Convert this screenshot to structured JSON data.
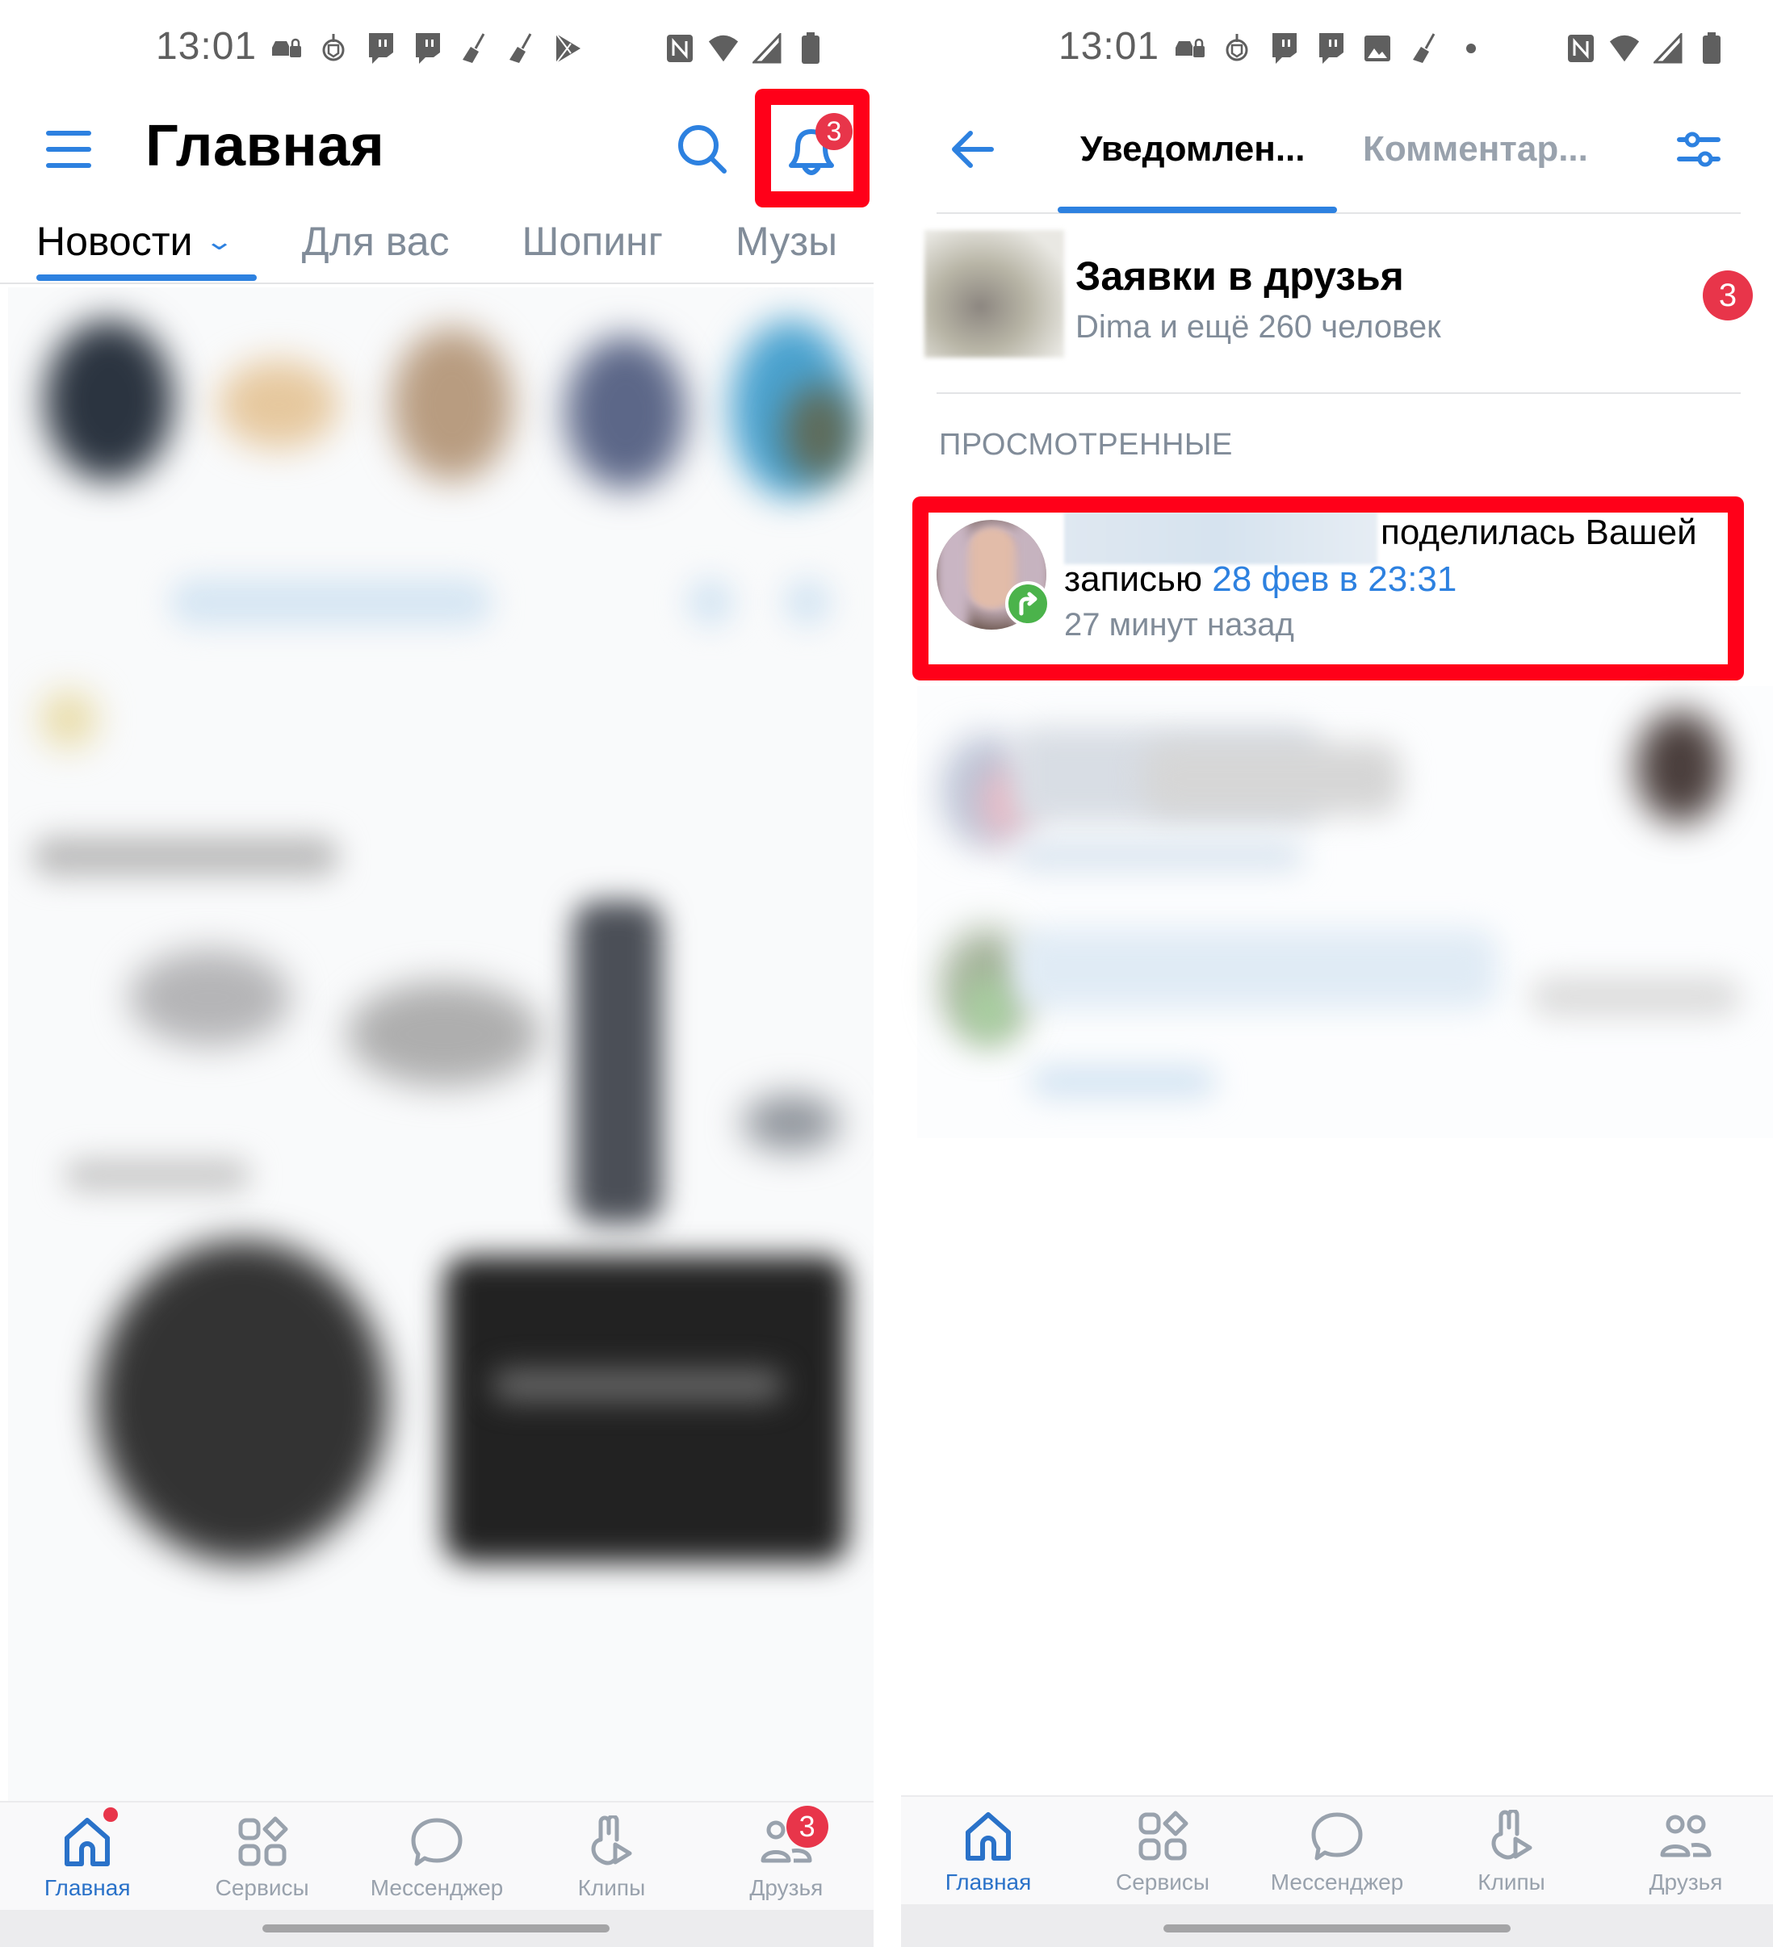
{
  "left": {
    "status_bar": {
      "time": "13:01",
      "notification_icons": [
        "car-lock-icon",
        "emblem-icon",
        "twitch-icon",
        "twitch-icon",
        "broom-icon",
        "broom-icon",
        "play-store-icon"
      ],
      "system_icons": [
        "nfc-icon",
        "wifi-icon",
        "signal-icon",
        "battery-icon"
      ]
    },
    "header": {
      "title": "Главная",
      "notifications_badge": "3"
    },
    "tabs": [
      {
        "label": "Новости",
        "active": true,
        "has_dropdown": true
      },
      {
        "label": "Для вас",
        "active": false
      },
      {
        "label": "Шопинг",
        "active": false
      },
      {
        "label": "Музыка",
        "active": false,
        "truncated_display": "Музы"
      }
    ],
    "bottom_nav": [
      {
        "label": "Главная",
        "icon": "home-icon",
        "active": true,
        "dot": true
      },
      {
        "label": "Сервисы",
        "icon": "services-icon",
        "active": false
      },
      {
        "label": "Мессенджер",
        "icon": "messenger-icon",
        "active": false
      },
      {
        "label": "Клипы",
        "icon": "clips-icon",
        "active": false
      },
      {
        "label": "Друзья",
        "icon": "friends-icon",
        "active": false,
        "badge": "3"
      }
    ]
  },
  "right": {
    "status_bar": {
      "time": "13:01",
      "notification_icons": [
        "car-lock-icon",
        "emblem-icon",
        "twitch-icon",
        "twitch-icon",
        "image-icon",
        "broom-icon",
        "dot-icon"
      ],
      "system_icons": [
        "nfc-icon",
        "wifi-icon",
        "signal-icon",
        "battery-icon"
      ]
    },
    "tabs": [
      {
        "label": "Уведомлен...",
        "active": true
      },
      {
        "label": "Комментар...",
        "active": false
      }
    ],
    "friend_requests": {
      "title": "Заявки в друзья",
      "subtitle": "Dima и ещё 260 человек",
      "badge": "3"
    },
    "section_header": "ПРОСМОТРЕННЫЕ",
    "notification": {
      "action_text": "поделилась Вашей",
      "object_text": "записью",
      "post_link": "28 фев в 23:31",
      "time_ago": "27 минут назад",
      "type_icon": "share-icon"
    },
    "bottom_nav": [
      {
        "label": "Главная",
        "icon": "home-icon",
        "active": true
      },
      {
        "label": "Сервисы",
        "icon": "services-icon",
        "active": false
      },
      {
        "label": "Мессенджер",
        "icon": "messenger-icon",
        "active": false
      },
      {
        "label": "Клипы",
        "icon": "clips-icon",
        "active": false
      },
      {
        "label": "Друзья",
        "icon": "friends-icon",
        "active": false
      }
    ]
  },
  "colors": {
    "accent": "#2d81e0",
    "highlight": "#ff0019",
    "badge": "#e8354a",
    "secondary_text": "#818c99",
    "share_green": "#4bb34b"
  }
}
